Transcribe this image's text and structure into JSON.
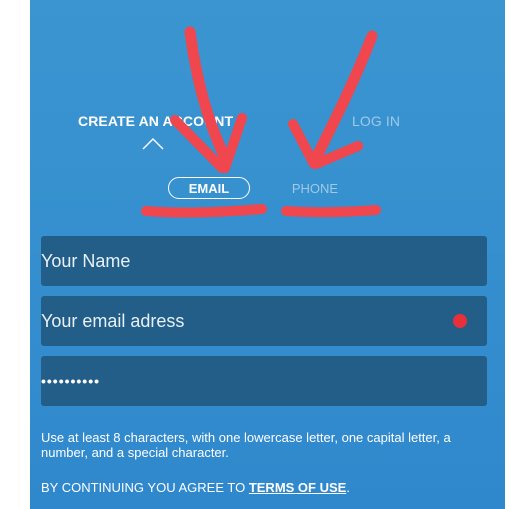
{
  "tabs": {
    "create_account": "CREATE AN ACCOUNT",
    "login": "LOG IN"
  },
  "segmented": {
    "email": "EMAIL",
    "phone": "PHONE"
  },
  "form": {
    "name_placeholder": "Your Name",
    "email_placeholder": "Your email adress",
    "password_value": "••••••••••"
  },
  "hint": "Use at least 8 characters, with one lowercase letter, one capital letter, a number, and a special character.",
  "terms": {
    "prefix": "BY CONTINUING YOU AGREE TO ",
    "link": "TERMS OF USE",
    "suffix": "."
  },
  "colors": {
    "background": "#3690cf",
    "field": "#235e89",
    "required_dot": "#e8303a",
    "annotation": "#f0464e"
  },
  "icons": {
    "tab_indicator": "caret-up-icon",
    "required": "required-dot-icon"
  }
}
